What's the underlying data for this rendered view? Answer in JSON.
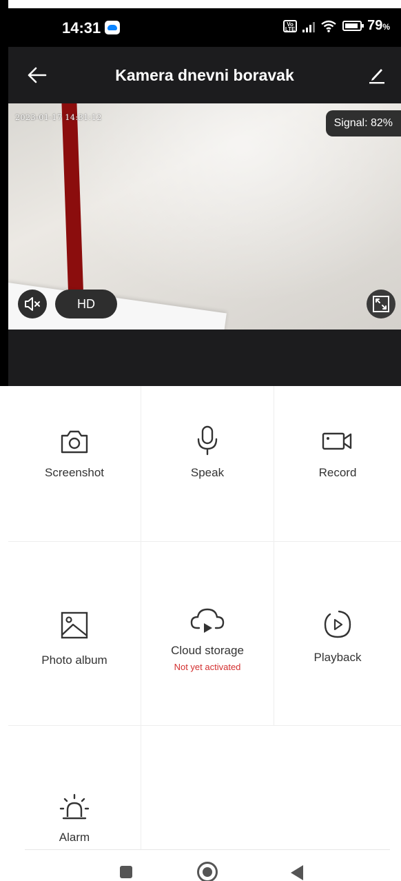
{
  "status_bar": {
    "time": "14:31",
    "volte_label": "Vo LTE",
    "battery_percent": "79",
    "battery_unit": "%"
  },
  "app_bar": {
    "title": "Kamera dnevni boravak"
  },
  "video": {
    "timestamp": "2023-01-17 14:31:12",
    "signal_label": "Signal: 82%",
    "quality_label": "HD"
  },
  "actions": [
    {
      "label": "Screenshot",
      "icon": "camera-icon"
    },
    {
      "label": "Speak",
      "icon": "microphone-icon"
    },
    {
      "label": "Record",
      "icon": "video-camera-icon"
    },
    {
      "label": "Photo album",
      "icon": "image-icon"
    },
    {
      "label": "Cloud storage",
      "sublabel": "Not yet activated",
      "icon": "cloud-play-icon"
    },
    {
      "label": "Playback",
      "icon": "playback-icon"
    },
    {
      "label": "Alarm",
      "icon": "alarm-siren-icon"
    }
  ],
  "colors": {
    "app_bar_bg": "#1c1c1e",
    "warning_text": "#d32f2f"
  }
}
